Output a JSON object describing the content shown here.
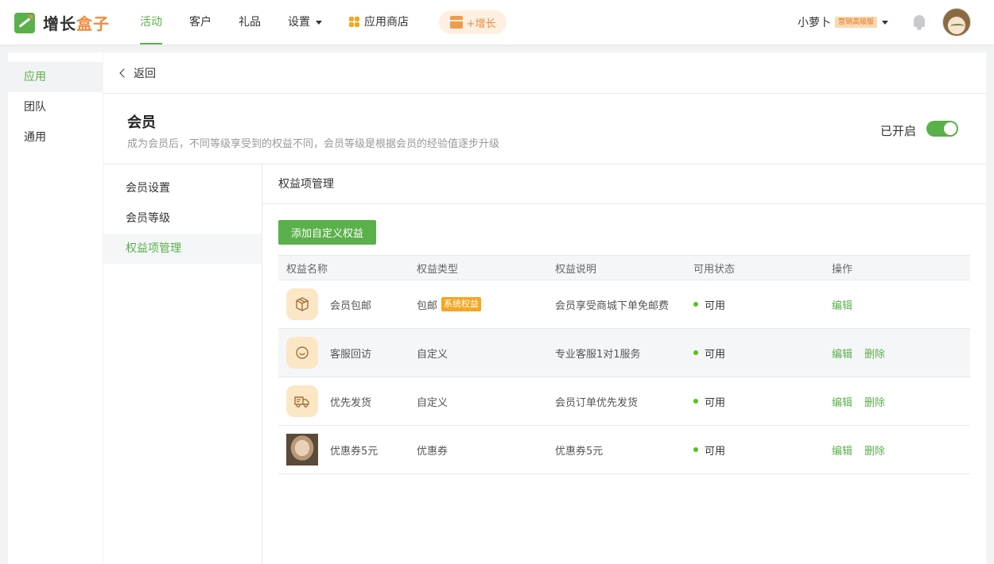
{
  "brand": {
    "name_part1": "增长",
    "name_part2": "盒子"
  },
  "nav": {
    "items": [
      {
        "label": "活动",
        "active": true
      },
      {
        "label": "客户"
      },
      {
        "label": "礼品"
      },
      {
        "label": "设置"
      },
      {
        "label": "应用商店"
      }
    ],
    "grow_label": "+增长"
  },
  "user": {
    "name": "小萝卜",
    "badge": "营销高级版"
  },
  "sidebar": {
    "items": [
      {
        "label": "应用"
      },
      {
        "label": "团队"
      },
      {
        "label": "通用"
      }
    ]
  },
  "back": {
    "label": "返回"
  },
  "header": {
    "title": "会员",
    "description": "成为会员后，不同等级享受到的权益不同，会员等级是根据会员的经验值逐步升级",
    "toggle_label": "已开启",
    "toggle_on": true
  },
  "subnav": {
    "items": [
      {
        "label": "会员设置"
      },
      {
        "label": "会员等级"
      },
      {
        "label": "权益项管理"
      }
    ]
  },
  "section": {
    "title": "权益项管理",
    "add_button": "添加自定义权益"
  },
  "table": {
    "columns": [
      "权益名称",
      "权益类型",
      "权益说明",
      "可用状态",
      "操作"
    ],
    "rows": [
      {
        "icon": "package-icon",
        "name": "会员包邮",
        "type": "包邮",
        "tag": "系统权益",
        "desc": "会员享受商城下单免邮费",
        "status": "可用",
        "edit": "编辑",
        "delete": ""
      },
      {
        "icon": "service-icon",
        "name": "客服回访",
        "type": "自定义",
        "tag": "",
        "desc": "专业客服1对1服务",
        "status": "可用",
        "edit": "编辑",
        "delete": "删除"
      },
      {
        "icon": "delivery-truck-icon",
        "name": "优先发货",
        "type": "自定义",
        "tag": "",
        "desc": "会员订单优先发货",
        "status": "可用",
        "edit": "编辑",
        "delete": "删除"
      },
      {
        "icon": "coupon-photo",
        "name": "优惠券5元",
        "type": "优惠券",
        "tag": "",
        "desc": "优惠券5元",
        "status": "可用",
        "edit": "编辑",
        "delete": "删除"
      }
    ]
  },
  "colors": {
    "accent": "#5ab04a",
    "orange": "#f08a3c",
    "tag": "#f5a623",
    "status_dot": "#52c41a"
  }
}
